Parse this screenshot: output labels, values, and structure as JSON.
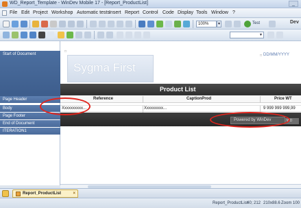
{
  "window": {
    "title": "WD_Report_Template - WinDev Mobile 17 - [Report_ProductList]",
    "minimize_label": "_"
  },
  "menu": {
    "items": [
      "File",
      "Edit",
      "Project",
      "Workshop",
      "Automatic tests",
      "Insert",
      "Report",
      "Control",
      "Code",
      "Display",
      "Tools",
      "Window",
      "?"
    ]
  },
  "toolbar": {
    "zoom_value": "100%",
    "test_label": "Test",
    "brand": "Dev"
  },
  "sections": {
    "start": "Start of Document",
    "page_header": "Page Header",
    "body": "Body",
    "page_footer": "Page Footer",
    "end": "End of Document",
    "iteration": "ITERATION1"
  },
  "report": {
    "header_title": "Sygma First",
    "date_field": "DD/MM/YYYY",
    "list_title": "Product List",
    "columns": [
      "Reference",
      "CaptionProd",
      "Price WT"
    ],
    "row": [
      "Xxxxxxxxxx...",
      "Xxxxxxxxx...",
      "9 999 999 999,99"
    ],
    "powered_by": "Powered by WinDev",
    "powered_tail": "WD"
  },
  "tabs": {
    "active": "Report_ProductList"
  },
  "status": {
    "report_name": "Report_ProductList",
    "position": "40; 212",
    "size": "210x88.6",
    "zoom": "Zoom 100"
  }
}
